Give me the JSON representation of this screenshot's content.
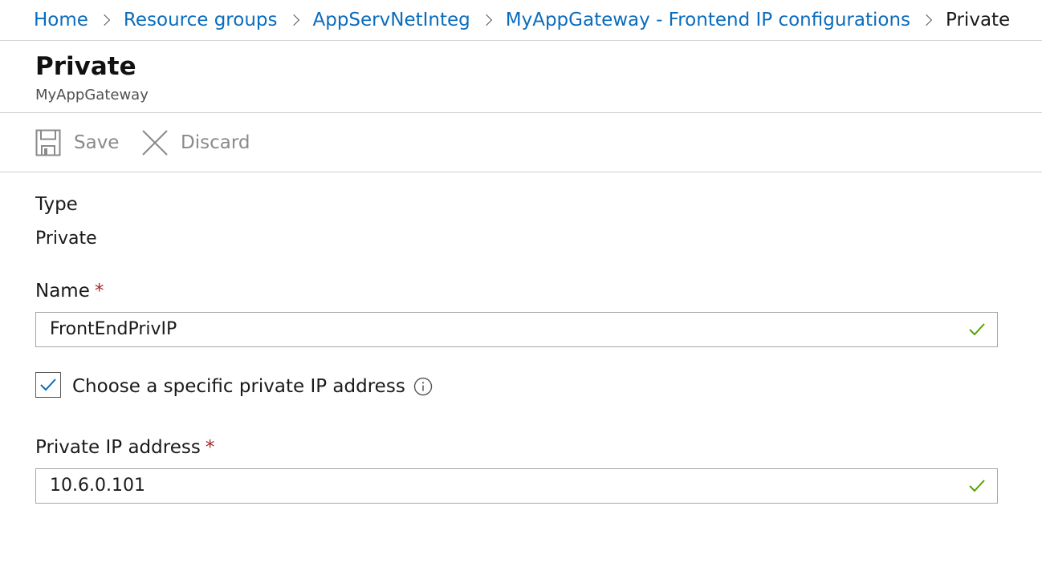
{
  "breadcrumb": {
    "items": [
      {
        "label": "Home"
      },
      {
        "label": "Resource groups"
      },
      {
        "label": "AppServNetInteg"
      },
      {
        "label": "MyAppGateway - Frontend IP configurations"
      },
      {
        "label": "Private"
      }
    ]
  },
  "header": {
    "title": "Private",
    "subtitle": "MyAppGateway"
  },
  "toolbar": {
    "save_label": "Save",
    "discard_label": "Discard",
    "save_icon": "save-icon",
    "discard_icon": "close-icon"
  },
  "form": {
    "type_label": "Type",
    "type_value": "Private",
    "name_label": "Name",
    "name_value": "FrontEndPrivIP",
    "required_marker": "*",
    "checkbox_label": "Choose a specific private IP address",
    "checkbox_checked": true,
    "ip_label": "Private IP address",
    "ip_value": "10.6.0.101"
  },
  "colors": {
    "link": "#0b6cbd",
    "required": "#a4262c",
    "valid_check": "#57a300",
    "disabled_text": "#8a8a8a"
  }
}
